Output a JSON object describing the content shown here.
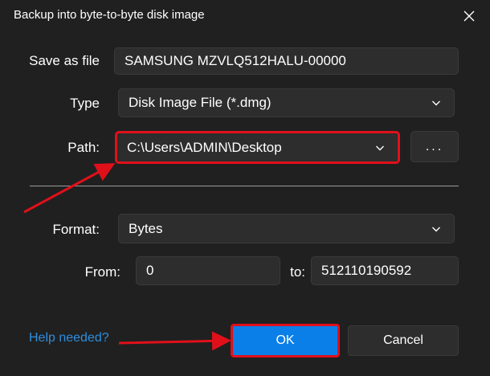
{
  "dialog": {
    "title": "Backup into byte-to-byte disk image"
  },
  "form": {
    "save_as_label": "Save as file",
    "save_as_value": "SAMSUNG MZVLQ512HALU-00000",
    "type_label": "Type",
    "type_value": "Disk Image File (*.dmg)",
    "path_label": "Path:",
    "path_value": "C:\\Users\\ADMIN\\Desktop",
    "browse_label": "...",
    "format_label": "Format:",
    "format_value": "Bytes",
    "from_label": "From:",
    "from_value": "0",
    "to_label": "to:",
    "to_value": "512110190592"
  },
  "footer": {
    "help_link": "Help needed?",
    "ok_label": "OK",
    "cancel_label": "Cancel"
  },
  "colors": {
    "background": "#202020",
    "field": "#2d2d2d",
    "accent": "#0a7fe8",
    "annotation": "#e0101a",
    "link": "#2c8fe0"
  },
  "icons": {
    "close": "close-icon",
    "dropdown": "chevron-down-icon"
  }
}
